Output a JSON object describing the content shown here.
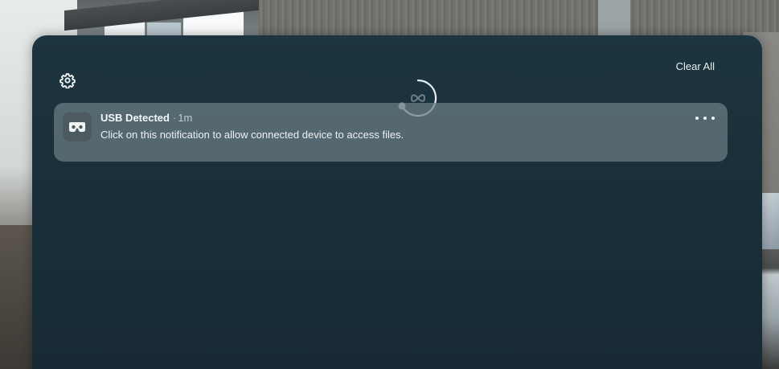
{
  "panel": {
    "clear_all_label": "Clear All",
    "settings_icon": "gear-icon",
    "loading_icon": "meta-logo-spinner-icon"
  },
  "notifications": [
    {
      "icon": "vr-headset-icon",
      "title": "USB Detected",
      "separator": "·",
      "time": "1m",
      "body": "Click on this notification to allow connected device to access files.",
      "menu_icon": "more-horizontal-icon"
    }
  ],
  "colors": {
    "panel_background": "#1a2f3a",
    "notification_background": "#6c7e85",
    "text_primary": "#f4f7f8"
  }
}
